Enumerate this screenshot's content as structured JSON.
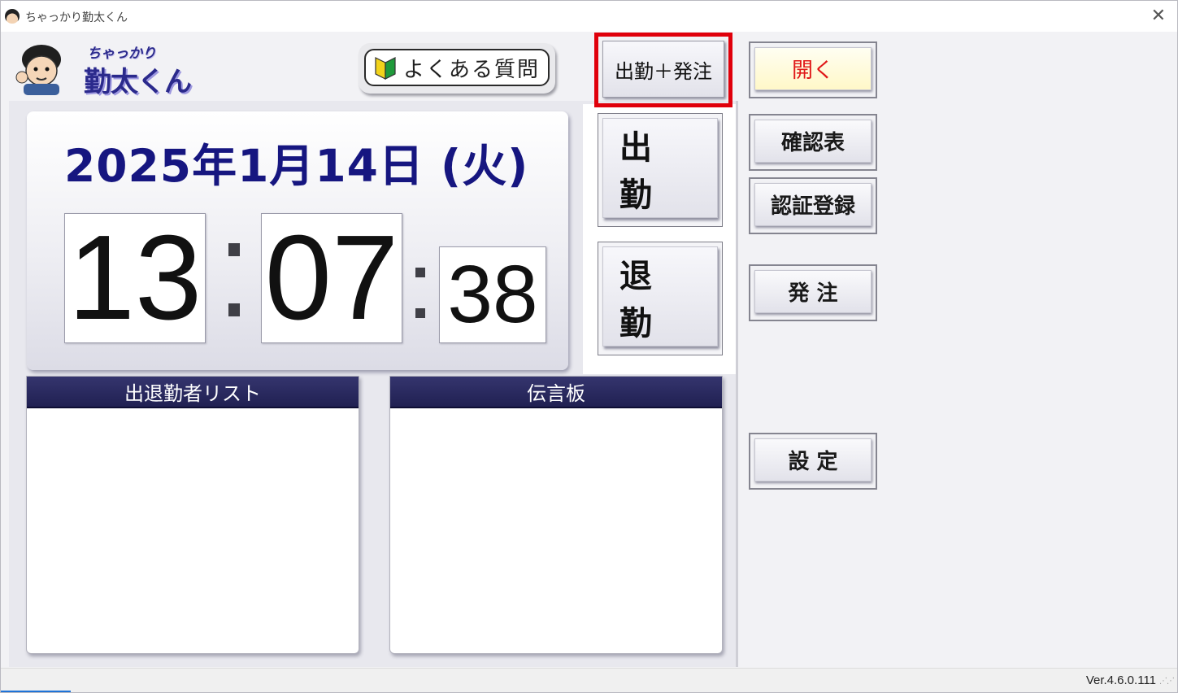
{
  "window": {
    "title": "ちゃっかり勤太くん",
    "close_glyph": "✕"
  },
  "logo": {
    "small_text": "ちゃっかり",
    "big_text": "勤太くん"
  },
  "faq_button": {
    "label": "よくある質問"
  },
  "clock": {
    "date": "2025年1月14日 (火)",
    "hours": "13",
    "minutes": "07",
    "seconds": "38"
  },
  "attendance": {
    "combo_label": "出勤＋発注",
    "clock_in_label": "出 勤",
    "clock_out_label": "退 勤"
  },
  "side_buttons": {
    "open": "開く",
    "check_sheet": "確認表",
    "auth_register": "認証登録",
    "order": "発 注",
    "settings": "設 定"
  },
  "lists": {
    "attendance_header": "出退勤者リスト",
    "message_header": "伝言板"
  },
  "statusbar": {
    "version": "Ver.4.6.0.111"
  },
  "colors": {
    "highlight": "#e0000b",
    "date_text": "#161680",
    "list_header": "#202052",
    "open_button_text": "#e01818"
  }
}
